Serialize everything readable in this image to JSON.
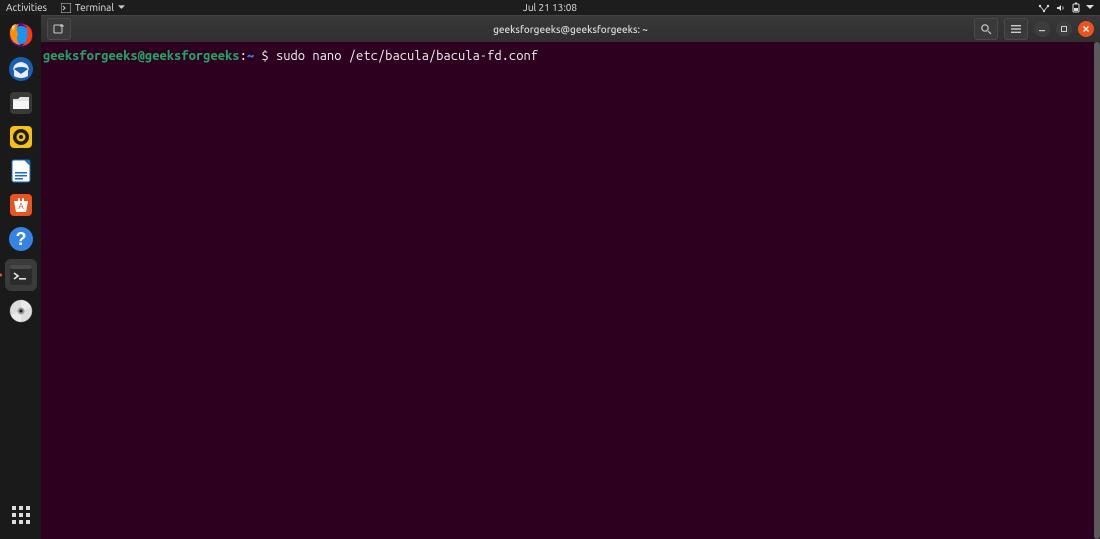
{
  "topbar": {
    "activities": "Activities",
    "terminal_menu": "Terminal",
    "datetime": "Jul 21  13:08"
  },
  "dock": {
    "items": [
      {
        "name": "firefox"
      },
      {
        "name": "thunderbird"
      },
      {
        "name": "files"
      },
      {
        "name": "rhythmbox"
      },
      {
        "name": "libreoffice-writer"
      },
      {
        "name": "ubuntu-software"
      },
      {
        "name": "help"
      },
      {
        "name": "terminal"
      },
      {
        "name": "disc"
      }
    ]
  },
  "window": {
    "title": "geeksforgeeks@geeksforgeeks: ~"
  },
  "terminal": {
    "prompt_user": "geeksforgeeks@geeksforgeeks",
    "prompt_sep": ":",
    "prompt_path": "~",
    "prompt_symbol": "$",
    "command": "sudo nano /etc/bacula/bacula-fd.conf"
  }
}
